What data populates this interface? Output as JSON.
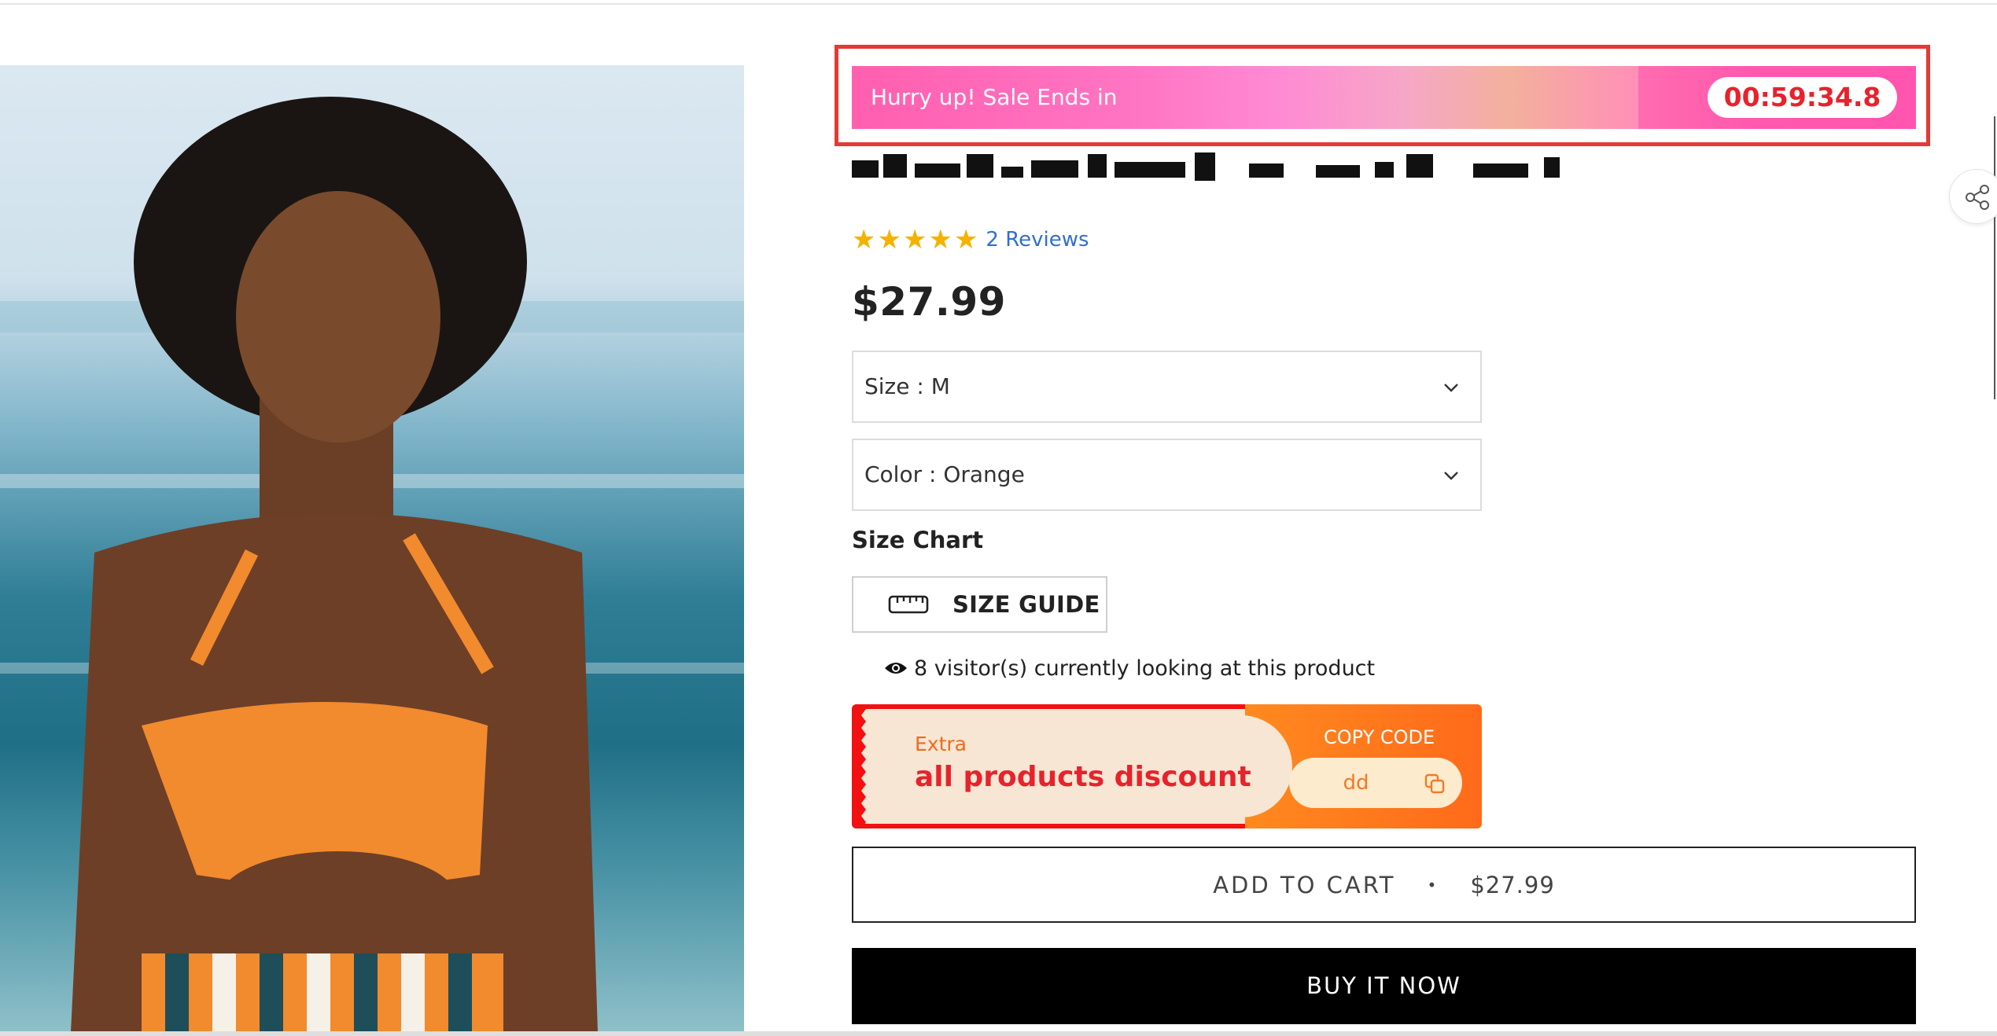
{
  "countdown": {
    "label": "Hurry up! Sale Ends in",
    "timer": "00:59:34.8"
  },
  "product": {
    "title": "",
    "rating": 5,
    "reviews_label": "2 Reviews",
    "price": "$27.99",
    "image_icon": "product-photo"
  },
  "options": {
    "size_label": "Size : M",
    "color_label": "Color : Orange"
  },
  "size_chart": {
    "title": "Size Chart",
    "guide_label": "SIZE GUIDE"
  },
  "visitors": {
    "text": "8 visitor(s) currently looking at this product"
  },
  "coupon": {
    "extra": "Extra",
    "title": "all products discount",
    "copy_label": "COPY CODE",
    "code": "dd"
  },
  "cart": {
    "add_label": "ADD TO CART",
    "separator": "•",
    "price": "$27.99",
    "buy_label": "BUY IT NOW"
  },
  "icons": {
    "share": "share-icon",
    "chevron": "chevron-down-icon",
    "ruler": "ruler-icon",
    "eye": "eye-icon",
    "copy": "copy-icon",
    "star": "star-icon"
  },
  "colors": {
    "accent_red": "#e8222c",
    "timer_gradient_start": "#ff5fae",
    "coupon_orange": "#ff7a1a",
    "star_gold": "#f5b200",
    "link_blue": "#2f6fd1"
  }
}
